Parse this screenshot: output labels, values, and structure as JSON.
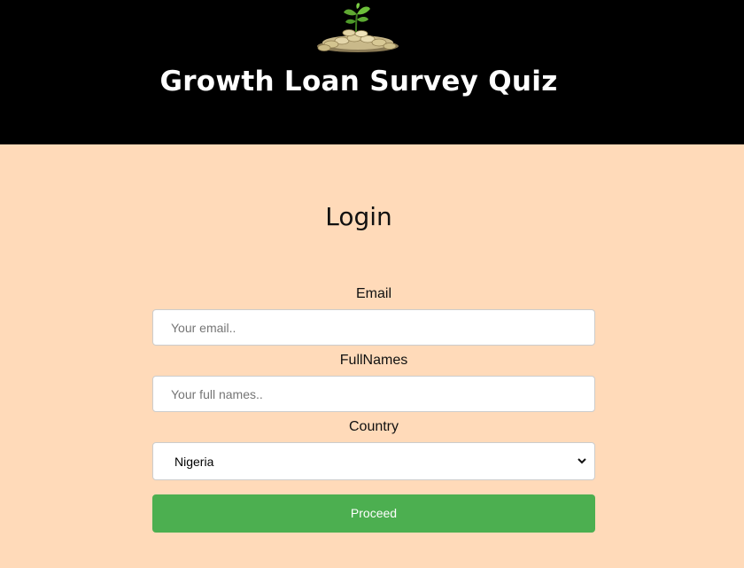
{
  "header": {
    "title": "Growth Loan Survey Quiz",
    "logo_icon": "seedling-on-coins-icon",
    "background": "#000000"
  },
  "login": {
    "title": "Login",
    "email": {
      "label": "Email",
      "placeholder": "Your email..",
      "value": ""
    },
    "fullnames": {
      "label": "FullNames",
      "placeholder": "Your full names..",
      "value": ""
    },
    "country": {
      "label": "Country",
      "selected": "Nigeria"
    },
    "proceed_label": "Proceed"
  },
  "colors": {
    "page_background": "#ffdab9",
    "button": "#4caf50",
    "button_text": "#ffffff"
  }
}
